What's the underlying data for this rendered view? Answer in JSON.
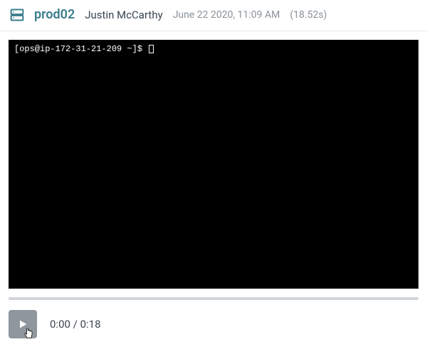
{
  "header": {
    "server_name": "prod02",
    "user_name": "Justin McCarthy",
    "timestamp": "June 22 2020, 11:09 AM",
    "duration": "(18.52s)"
  },
  "terminal": {
    "prompt_line": "[ops@ip-172-31-21-209 ~]$ "
  },
  "player": {
    "current_time": "0:00",
    "total_time": "0:18",
    "separator": " / "
  }
}
